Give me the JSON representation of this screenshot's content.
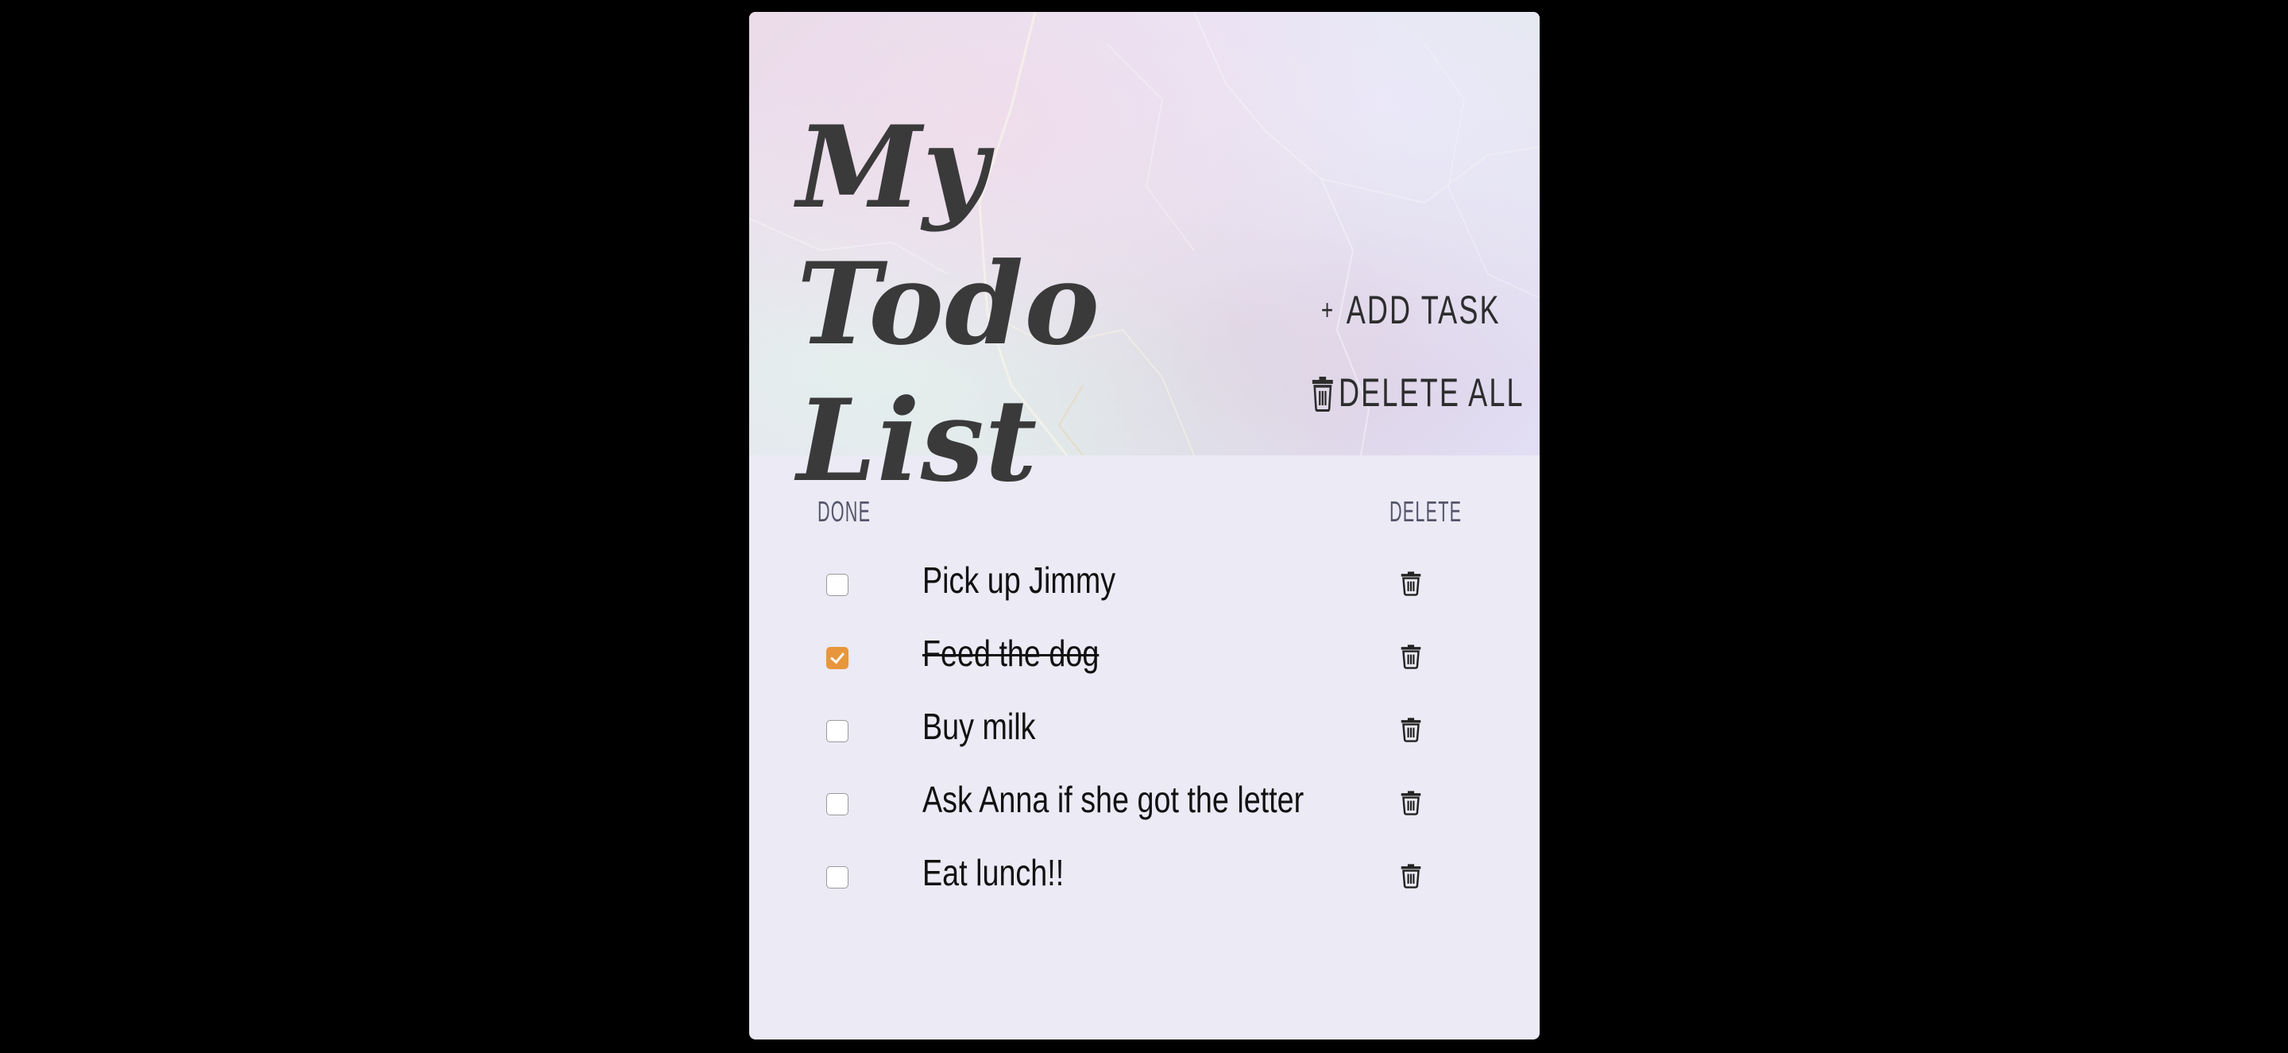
{
  "app": {
    "title": "My Todo List",
    "title_line1": "My Todo",
    "title_line2": "List",
    "accent_color": "#e8963a",
    "panel_color": "#ebeaf5"
  },
  "actions": {
    "add_task_label": "ADD TASK",
    "add_task_icon": "plus-icon",
    "delete_all_label": "DELETE ALL",
    "delete_all_icon": "trash-icon"
  },
  "columns": {
    "done_label": "DONE",
    "delete_label": "DELETE"
  },
  "tasks": [
    {
      "text": "Pick up Jimmy",
      "done": false
    },
    {
      "text": "Feed the dog",
      "done": true
    },
    {
      "text": "Buy milk",
      "done": false
    },
    {
      "text": "Ask Anna if she got the letter",
      "done": false
    },
    {
      "text": "Eat lunch!!",
      "done": false
    }
  ]
}
